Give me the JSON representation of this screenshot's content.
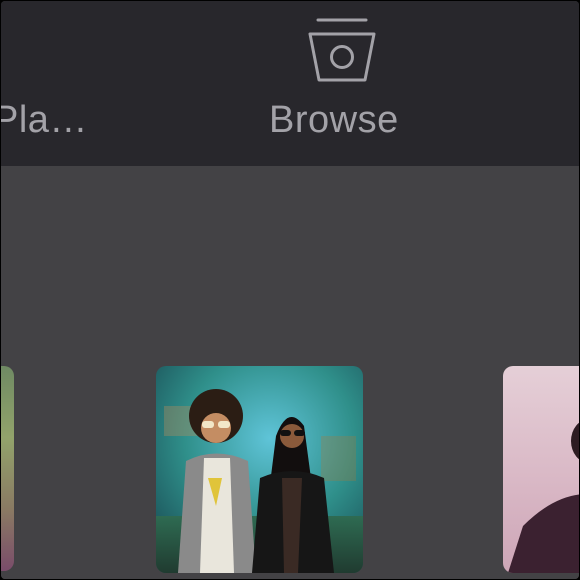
{
  "tabbar": {
    "tabs": [
      {
        "label": "Pla…",
        "icon": "playlist-icon"
      },
      {
        "label": "Browse",
        "icon": "browse-icon"
      }
    ],
    "colors": {
      "background": "#28272c",
      "label": "#a3a2a8"
    }
  },
  "content": {
    "background": "#434245",
    "album_art": [
      {
        "name": "album-art-left"
      },
      {
        "name": "album-art-center"
      },
      {
        "name": "album-art-right"
      }
    ]
  }
}
